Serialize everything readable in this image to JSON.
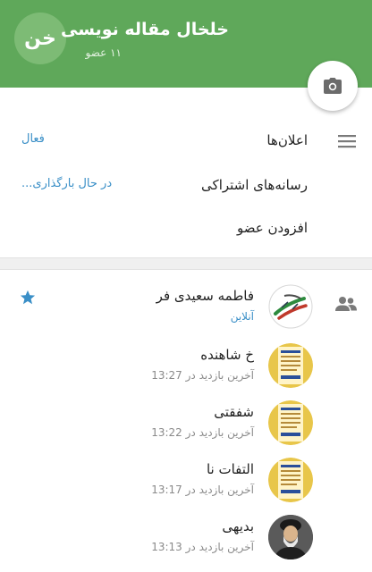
{
  "header": {
    "avatar_initials": "خن",
    "title": "خلخال مقاله نویسی",
    "members_count": "۱۱ عضو",
    "camera_icon": "camera-icon"
  },
  "settings": {
    "icon": "list-icon",
    "items": [
      {
        "label": "اعلان‌ها",
        "value": "فعال"
      },
      {
        "label": "رسانه‌های اشتراکی",
        "value": "در حال بارگذاری..."
      },
      {
        "label": "افزودن عضو",
        "value": ""
      }
    ]
  },
  "members": {
    "icon": "group-icon",
    "list": [
      {
        "name": "فاطمه سعیدی فر",
        "status": "آنلاین",
        "online": true,
        "admin": true
      },
      {
        "name": "خ شاهنده",
        "status": "آخرین بازدید در 13:27",
        "online": false,
        "admin": false
      },
      {
        "name": "شفقتی",
        "status": "آخرین بازدید در 13:22",
        "online": false,
        "admin": false
      },
      {
        "name": "التفات نا",
        "status": "آخرین بازدید در 13:17",
        "online": false,
        "admin": false
      },
      {
        "name": "بدیهی",
        "status": "آخرین بازدید در 13:13",
        "online": false,
        "admin": false
      }
    ]
  },
  "colors": {
    "header_green": "#5fa85a",
    "link_blue": "#3a8fc7",
    "star_blue": "#3a8fc7"
  }
}
